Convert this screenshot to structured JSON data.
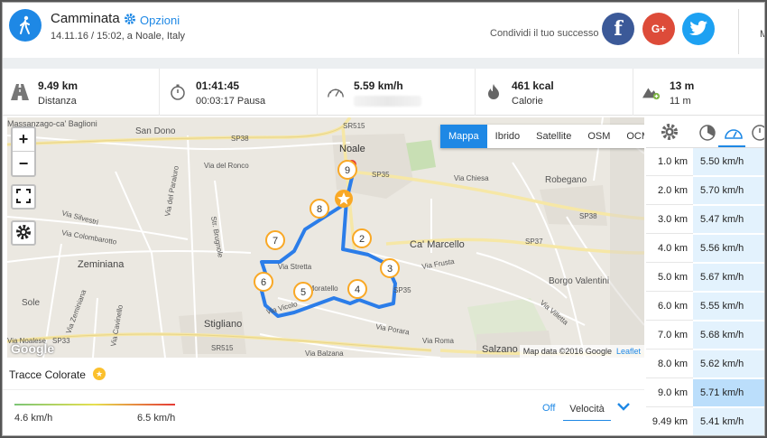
{
  "header": {
    "title": "Camminata",
    "options_label": "Opzioni",
    "subtitle": "14.11.16 / 15:02, a Noale, Italy",
    "share_label": "Condividi il tuo successo",
    "facebook": "f",
    "google": "G+",
    "right_cut": "M"
  },
  "stats": [
    {
      "icon": "road-icon",
      "value": "9.49 km",
      "label": "Distanza"
    },
    {
      "icon": "stopwatch-icon",
      "value": "01:41:45",
      "label": "00:03:17 Pausa"
    },
    {
      "icon": "speedometer-icon",
      "value": "5.59 km/h",
      "label": ""
    },
    {
      "icon": "flame-icon",
      "value": "461 kcal",
      "label": "Calorie"
    },
    {
      "icon": "mountain-icon",
      "value": "13 m",
      "label": "11 m"
    }
  ],
  "map": {
    "layers": [
      "Mappa",
      "Ibrido",
      "Satellite",
      "OSM",
      "OCM"
    ],
    "active_layer": "Mappa",
    "zoom_in": "+",
    "zoom_out": "−",
    "attribution": "Map data ©2016 Google",
    "leaflet": "Leaflet",
    "google": "Google",
    "labels": [
      "Massanzago-ca' Baglioni",
      "San Dono",
      "SR515",
      "SP38",
      "Noale",
      "SP35",
      "Via del Ronco",
      "Via del Paraiuro",
      "Str. Brugnole",
      "Via Silvestri",
      "Via Colombarotto",
      "Robegano",
      "Via Chiesa",
      "SP38",
      "Ca' Marcello",
      "SP37",
      "Via Stretta",
      "Via Frusta",
      "Via Moratello",
      "Zeminiana",
      "SP35",
      "Sole",
      "Via Zeminiana",
      "Via Cavinello",
      "Borgo Valentini",
      "Via Vicolo",
      "Via Villetta",
      "SP33",
      "Stigliano",
      "SR515",
      "Via Balzana",
      "Salzano",
      "Via Porara",
      "Via Roma",
      "Via Noalese"
    ],
    "markers": [
      "2",
      "3",
      "4",
      "5",
      "6",
      "7",
      "8",
      "9"
    ]
  },
  "sidebar": {
    "rows": [
      {
        "km": "1.0 km",
        "speed": "5.50 km/h"
      },
      {
        "km": "2.0 km",
        "speed": "5.70 km/h"
      },
      {
        "km": "3.0 km",
        "speed": "5.47 km/h"
      },
      {
        "km": "4.0 km",
        "speed": "5.56 km/h"
      },
      {
        "km": "5.0 km",
        "speed": "5.67 km/h"
      },
      {
        "km": "6.0 km",
        "speed": "5.55 km/h"
      },
      {
        "km": "7.0 km",
        "speed": "5.68 km/h"
      },
      {
        "km": "8.0 km",
        "speed": "5.62 km/h"
      },
      {
        "km": "9.0 km",
        "speed": "5.71 km/h"
      },
      {
        "km": "9.49 km",
        "speed": "5.41 km/h"
      }
    ]
  },
  "bottom": {
    "title": "Tracce Colorate",
    "min": "4.6 km/h",
    "max": "6.5 km/h",
    "off": "Off",
    "select": "Velocità"
  },
  "colors": {
    "accent": "#1e88e5",
    "facebook": "#3b5998",
    "google": "#dd4b39",
    "twitter": "#1da1f2",
    "route": "#2b7de9",
    "marker": "#f9a825"
  }
}
